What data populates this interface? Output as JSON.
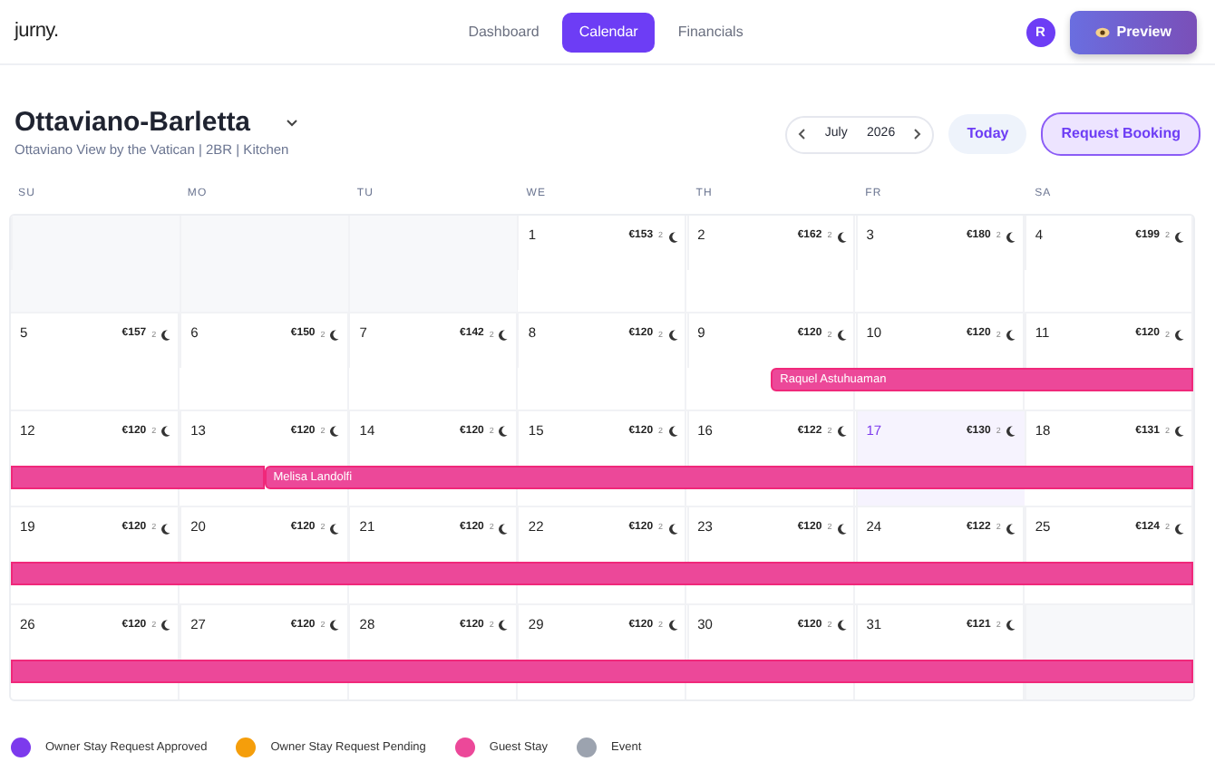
{
  "brand": "jurny.",
  "nav": [
    {
      "label": "Dashboard",
      "selected": false
    },
    {
      "label": "Calendar",
      "selected": true
    },
    {
      "label": "Financials",
      "selected": false
    }
  ],
  "avatar": "R",
  "preview_button": "Preview",
  "property": {
    "name": "Ottaviano-Barletta",
    "subtitle": "Ottaviano View by the Vatican | 2BR | Kitchen"
  },
  "month_picker": {
    "month": "July",
    "year": "2026"
  },
  "today_button": "Today",
  "request_button": "Request Booking",
  "weekdays": [
    "SU",
    "MO",
    "TU",
    "WE",
    "TH",
    "FR",
    "SA"
  ],
  "weeks": [
    {
      "days": [
        {
          "blank": true
        },
        {
          "blank": true
        },
        {
          "blank": true
        },
        {
          "day": "1",
          "price": "€153",
          "min_nights": "2"
        },
        {
          "day": "2",
          "price": "€162",
          "min_nights": "2"
        },
        {
          "day": "3",
          "price": "€180",
          "min_nights": "2"
        },
        {
          "day": "4",
          "price": "€199",
          "min_nights": "2"
        }
      ]
    },
    {
      "days": [
        {
          "day": "5",
          "price": "€157",
          "min_nights": "2"
        },
        {
          "day": "6",
          "price": "€150",
          "min_nights": "2"
        },
        {
          "day": "7",
          "price": "€142",
          "min_nights": "2"
        },
        {
          "day": "8",
          "price": "€120",
          "min_nights": "2"
        },
        {
          "day": "9",
          "price": "€120",
          "min_nights": "2",
          "check_in": {
            "guest": "Raquel Astuhuaman",
            "kind": "guest_stay"
          }
        },
        {
          "day": "10",
          "price": "€120",
          "min_nights": "2"
        },
        {
          "day": "11",
          "price": "€120",
          "min_nights": "2"
        }
      ]
    },
    {
      "days": [
        {
          "day": "12",
          "price": "€120",
          "min_nights": "2"
        },
        {
          "day": "13",
          "price": "€120",
          "min_nights": "2",
          "check_out": true,
          "check_in": {
            "guest": "Melisa Landolfi",
            "kind": "guest_stay"
          }
        },
        {
          "day": "14",
          "price": "€120",
          "min_nights": "2"
        },
        {
          "day": "15",
          "price": "€120",
          "min_nights": "2"
        },
        {
          "day": "16",
          "price": "€122",
          "min_nights": "2"
        },
        {
          "day": "17",
          "price": "€130",
          "min_nights": "2",
          "today": true
        },
        {
          "day": "18",
          "price": "€131",
          "min_nights": "2"
        }
      ]
    },
    {
      "days": [
        {
          "day": "19",
          "price": "€120",
          "min_nights": "2"
        },
        {
          "day": "20",
          "price": "€120",
          "min_nights": "2"
        },
        {
          "day": "21",
          "price": "€120",
          "min_nights": "2"
        },
        {
          "day": "22",
          "price": "€120",
          "min_nights": "2"
        },
        {
          "day": "23",
          "price": "€120",
          "min_nights": "2"
        },
        {
          "day": "24",
          "price": "€122",
          "min_nights": "2"
        },
        {
          "day": "25",
          "price": "€124",
          "min_nights": "2"
        }
      ]
    },
    {
      "days": [
        {
          "day": "26",
          "price": "€120",
          "min_nights": "2"
        },
        {
          "day": "27",
          "price": "€120",
          "min_nights": "2"
        },
        {
          "day": "28",
          "price": "€120",
          "min_nights": "2"
        },
        {
          "day": "29",
          "price": "€120",
          "min_nights": "2"
        },
        {
          "day": "30",
          "price": "€120",
          "min_nights": "2"
        },
        {
          "day": "31",
          "price": "€121",
          "min_nights": "2"
        },
        {
          "blank": true
        }
      ]
    }
  ],
  "legend": [
    {
      "label": "Owner Stay Request Approved",
      "color": "#7c3aed"
    },
    {
      "label": "Owner Stay Request Pending",
      "color": "#f59e0b"
    },
    {
      "label": "Guest Stay",
      "color": "#ec4899"
    },
    {
      "label": "Event",
      "color": "#9ca3af"
    }
  ]
}
